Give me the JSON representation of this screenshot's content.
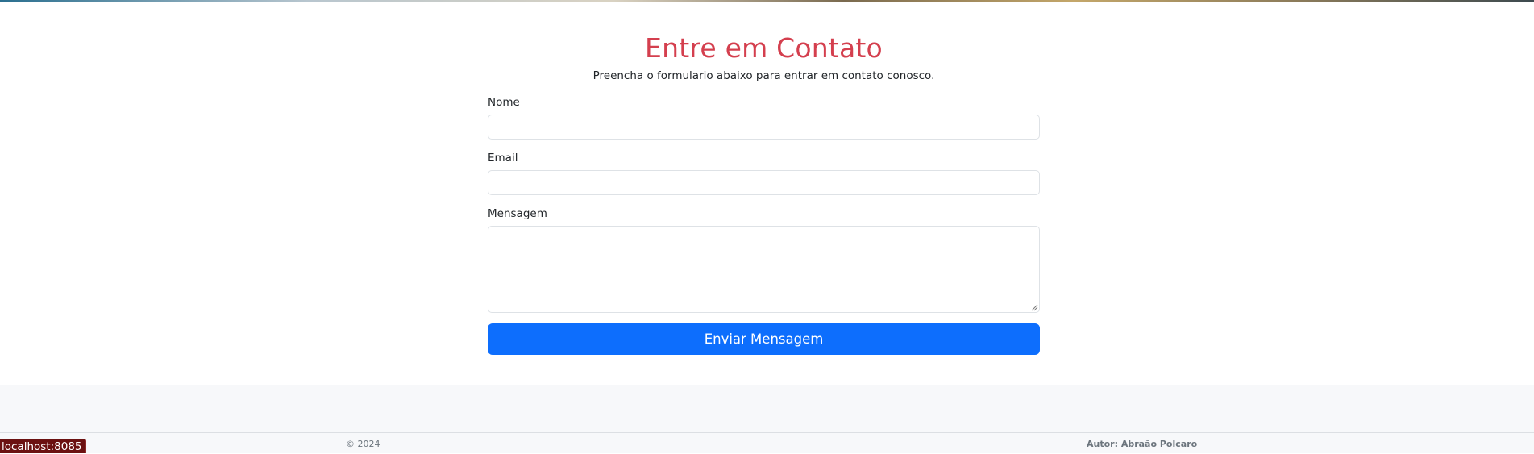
{
  "contact": {
    "title": "Entre em Contato",
    "subtitle": "Preencha o formulario abaixo para entrar em contato conosco.",
    "fields": {
      "name": {
        "label": "Nome",
        "value": ""
      },
      "email": {
        "label": "Email",
        "value": ""
      },
      "message": {
        "label": "Mensagem",
        "value": ""
      }
    },
    "submit_label": "Enviar Mensagem"
  },
  "footer": {
    "copyright": "© 2024",
    "author": "Autor: Abraão Polcaro"
  },
  "status_bar": {
    "url": "localhost:8085"
  },
  "colors": {
    "title": "#d43f4e",
    "button": "#0d6efd",
    "footer_background": "#f7f8fa",
    "status_bar_background": "#6b1111"
  }
}
